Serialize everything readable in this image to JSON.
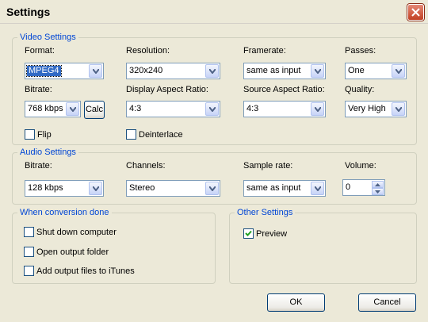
{
  "window": {
    "title": "Settings"
  },
  "video": {
    "legend": "Video Settings",
    "format_label": "Format:",
    "format_value": "MPEG4",
    "resolution_label": "Resolution:",
    "resolution_value": "320x240",
    "framerate_label": "Framerate:",
    "framerate_value": "same as input",
    "passes_label": "Passes:",
    "passes_value": "One",
    "bitrate_label": "Bitrate:",
    "bitrate_value": "768 kbps",
    "calc_label": "Calc",
    "dar_label": "Display Aspect Ratio:",
    "dar_value": "4:3",
    "sar_label": "Source Aspect Ratio:",
    "sar_value": "4:3",
    "quality_label": "Quality:",
    "quality_value": "Very High",
    "flip_label": "Flip",
    "flip_checked": false,
    "deinterlace_label": "Deinterlace",
    "deinterlace_checked": false
  },
  "audio": {
    "legend": "Audio Settings",
    "bitrate_label": "Bitrate:",
    "bitrate_value": "128 kbps",
    "channels_label": "Channels:",
    "channels_value": "Stereo",
    "samplerate_label": "Sample rate:",
    "samplerate_value": "same as input",
    "volume_label": "Volume:",
    "volume_value": "0"
  },
  "conversion": {
    "legend": "When conversion done",
    "shutdown_label": "Shut down computer",
    "open_folder_label": "Open output folder",
    "itunes_label": "Add output files to iTunes"
  },
  "other": {
    "legend": "Other Settings",
    "preview_label": "Preview",
    "preview_checked": true
  },
  "buttons": {
    "ok": "OK",
    "cancel": "Cancel"
  }
}
